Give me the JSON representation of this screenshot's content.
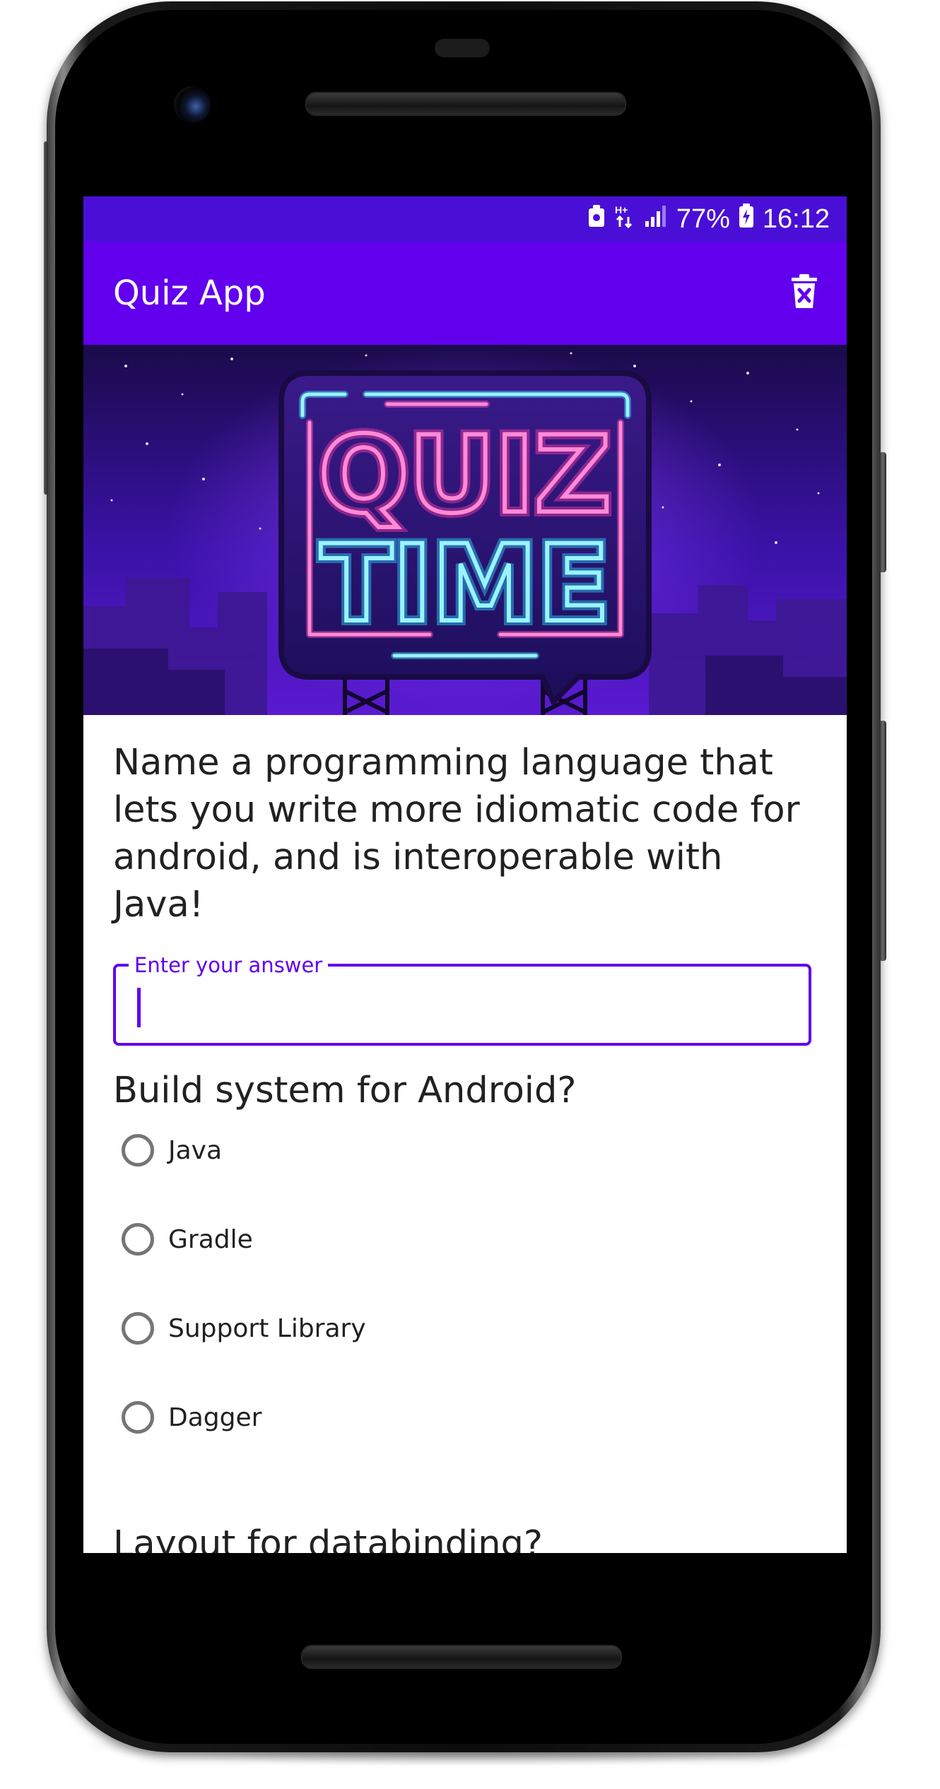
{
  "status_bar": {
    "battery_percent": "77%",
    "time": "16:12",
    "network": "H+",
    "icons": [
      "notification-icon",
      "network-type-icon",
      "signal-icon",
      "battery-charging-icon"
    ]
  },
  "app_bar": {
    "title": "Quiz App",
    "action_icon": "delete-forever-icon"
  },
  "banner": {
    "line1": "QUIZ",
    "line2": "TIME"
  },
  "questions": [
    {
      "text": "Name a programming language that lets you write more idiomatic code for android, and is interoperable with Java!",
      "type": "text",
      "field_label": "Enter your answer",
      "value": ""
    },
    {
      "text": "Build system for Android?",
      "type": "radio",
      "options": [
        "Java",
        "Gradle",
        "Support Library",
        "Dagger"
      ]
    },
    {
      "text": "Layout for databinding?",
      "type": "partial"
    }
  ],
  "colors": {
    "primary": "#6200ee",
    "status_bar": "#4a0fd6",
    "text": "#212121",
    "radio_unchecked": "#757575"
  }
}
